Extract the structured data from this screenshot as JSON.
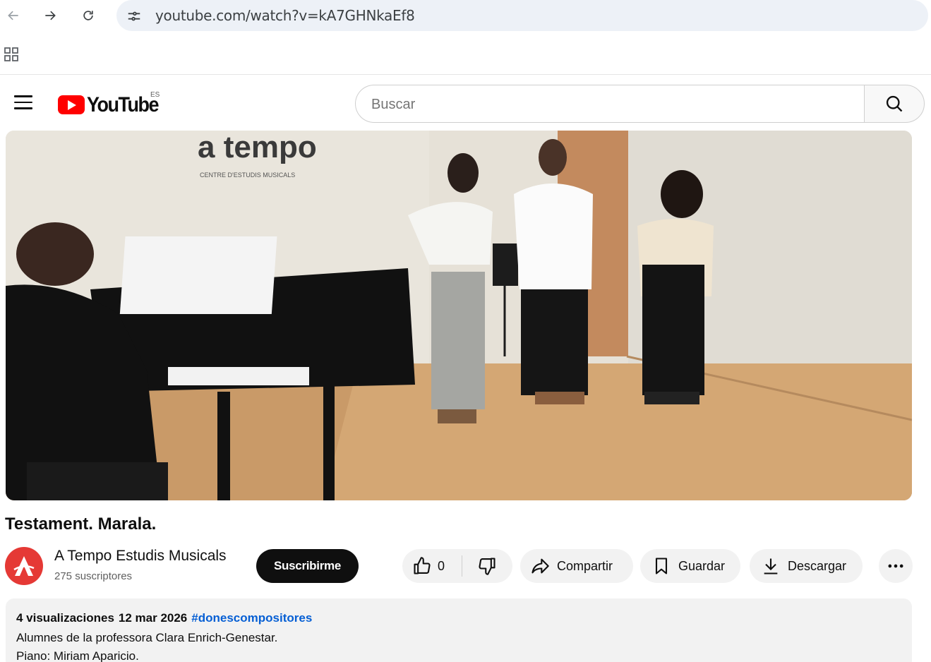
{
  "browser": {
    "url": "youtube.com/watch?v=kA7GHNkaEf8"
  },
  "header": {
    "logo_text": "YouTube",
    "country_code": "ES",
    "search_placeholder": "Buscar"
  },
  "video": {
    "title": "Testament. Marala.",
    "overlay_brand": "a tempo",
    "overlay_subtitle": "CENTRE D'ESTUDIS MUSICALS"
  },
  "channel": {
    "name": "A Tempo Estudis Musicals",
    "subscribers": "275 suscriptores",
    "subscribe_label": "Suscribirme"
  },
  "actions": {
    "like_count": "0",
    "share_label": "Compartir",
    "save_label": "Guardar",
    "download_label": "Descargar"
  },
  "description": {
    "views": "4 visualizaciones",
    "date": "12 mar 2026",
    "hashtag": "#donescompositores",
    "line1": "Alumnes de la professora Clara Enrich-Genestar.",
    "line2": "Piano: Miriam Aparicio."
  },
  "colors": {
    "brand_red": "#ff0000",
    "link_blue": "#065fd4",
    "subscribe_bg": "#0f0f0f"
  }
}
